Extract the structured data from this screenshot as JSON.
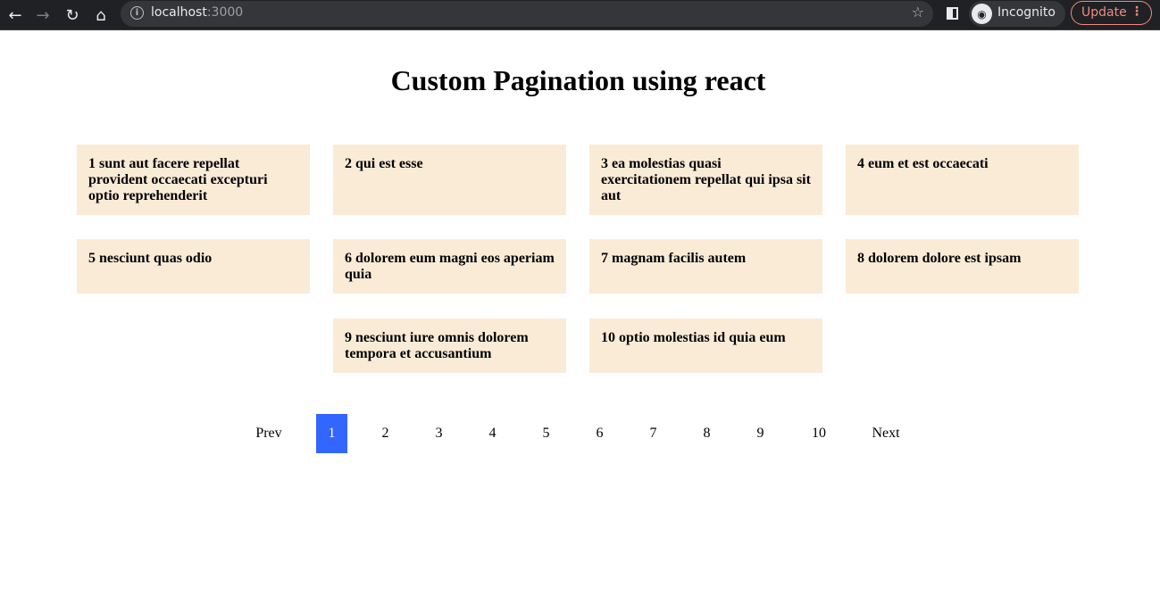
{
  "browser": {
    "url_host": "localhost",
    "url_port": ":3000",
    "profile_label": "Incognito",
    "update_label": "Update",
    "icons": {
      "back": "arrow-left-icon",
      "forward": "arrow-right-icon",
      "reload": "reload-icon",
      "home": "home-icon",
      "info": "info-icon",
      "bookmark": "star-icon",
      "side_panel": "side-panel-icon",
      "incognito": "incognito-icon",
      "menu": "kebab-menu-icon"
    }
  },
  "page": {
    "title": "Custom Pagination using react"
  },
  "posts": [
    {
      "id": 1,
      "text": "1 sunt aut facere repellat provident occaecati excepturi optio reprehenderit"
    },
    {
      "id": 2,
      "text": "2 qui est esse"
    },
    {
      "id": 3,
      "text": "3 ea molestias quasi exercitationem repellat qui ipsa sit aut"
    },
    {
      "id": 4,
      "text": "4 eum et est occaecati"
    },
    {
      "id": 5,
      "text": "5 nesciunt quas odio"
    },
    {
      "id": 6,
      "text": "6 dolorem eum magni eos aperiam quia"
    },
    {
      "id": 7,
      "text": "7 magnam facilis autem"
    },
    {
      "id": 8,
      "text": "8 dolorem dolore est ipsam"
    },
    {
      "id": 9,
      "text": "9 nesciunt iure omnis dolorem tempora et accusantium"
    },
    {
      "id": 10,
      "text": "10 optio molestias id quia eum"
    }
  ],
  "pagination": {
    "prev_label": "Prev",
    "next_label": "Next",
    "pages": [
      "1",
      "2",
      "3",
      "4",
      "5",
      "6",
      "7",
      "8",
      "9",
      "10"
    ],
    "current_page": "1",
    "active_color": "#3366ff"
  },
  "colors": {
    "card_background": "#faebd7",
    "chrome_background": "#202124",
    "update_accent": "#f28b82"
  }
}
